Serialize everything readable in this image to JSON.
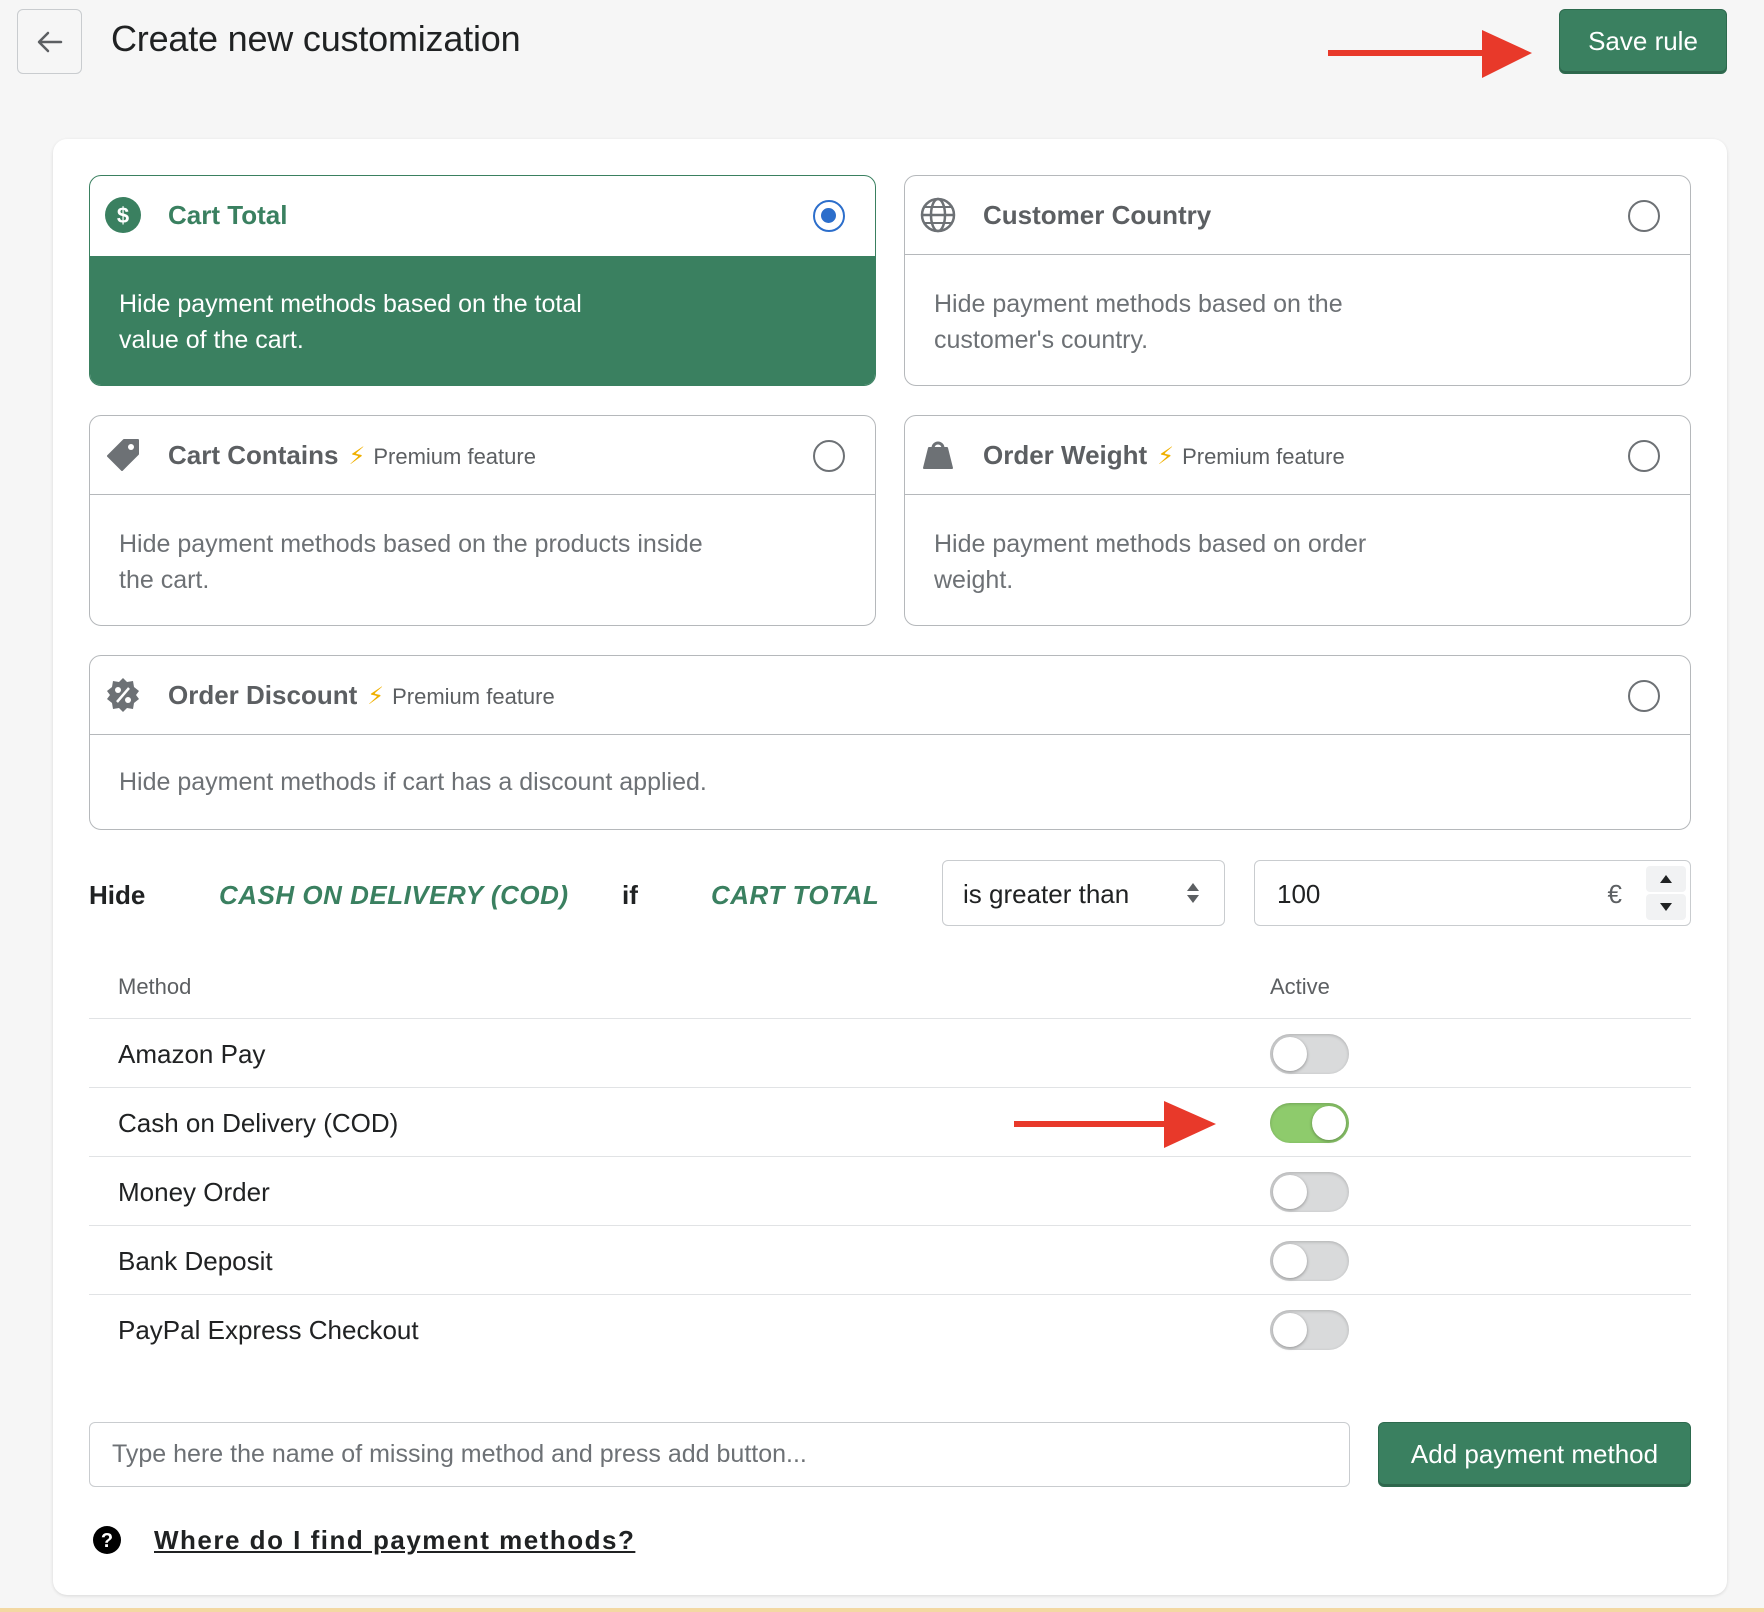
{
  "header": {
    "title": "Create new customization",
    "save_label": "Save rule",
    "back_icon": "arrow-left-icon"
  },
  "options": [
    {
      "title": "Cart Total",
      "premium": "",
      "description": "Hide payment methods based on the total value of the cart.",
      "selected": true,
      "icon": "dollar-circle-icon"
    },
    {
      "title": "Customer Country",
      "premium": "",
      "description": "Hide payment methods based on the customer's country.",
      "selected": false,
      "icon": "globe-icon"
    },
    {
      "title": "Cart Contains",
      "premium": "Premium feature",
      "description": "Hide payment methods based on the products inside the cart.",
      "selected": false,
      "icon": "tag-icon"
    },
    {
      "title": "Order Weight",
      "premium": "Premium feature",
      "description": "Hide payment methods based on order weight.",
      "selected": false,
      "icon": "weight-icon"
    },
    {
      "title": "Order Discount",
      "premium": "Premium feature",
      "description": "Hide payment methods if cart has a discount applied.",
      "selected": false,
      "icon": "discount-badge-icon"
    }
  ],
  "rule": {
    "hide": "Hide",
    "method": "CASH ON DELIVERY (COD)",
    "if": "if",
    "condition": "CART TOTAL",
    "operator": "is greater than",
    "amount": "100",
    "currency": "€"
  },
  "methods_table": {
    "col_method": "Method",
    "col_active": "Active",
    "rows": [
      {
        "name": "Amazon Pay",
        "active": false
      },
      {
        "name": "Cash on Delivery (COD)",
        "active": true
      },
      {
        "name": "Money Order",
        "active": false
      },
      {
        "name": "Bank Deposit",
        "active": false
      },
      {
        "name": "PayPal Express Checkout",
        "active": false
      }
    ]
  },
  "add_method": {
    "placeholder": "Type here the name of missing method and press add button...",
    "button_label": "Add payment method"
  },
  "help": {
    "link": "Where do I find payment methods?"
  },
  "colors": {
    "brand_green": "#3a8060",
    "toggle_on": "#8ecb6c",
    "radio_blue": "#2c6ecb",
    "annotation_red": "#e8392a",
    "premium_bolt": "#f0b000"
  }
}
